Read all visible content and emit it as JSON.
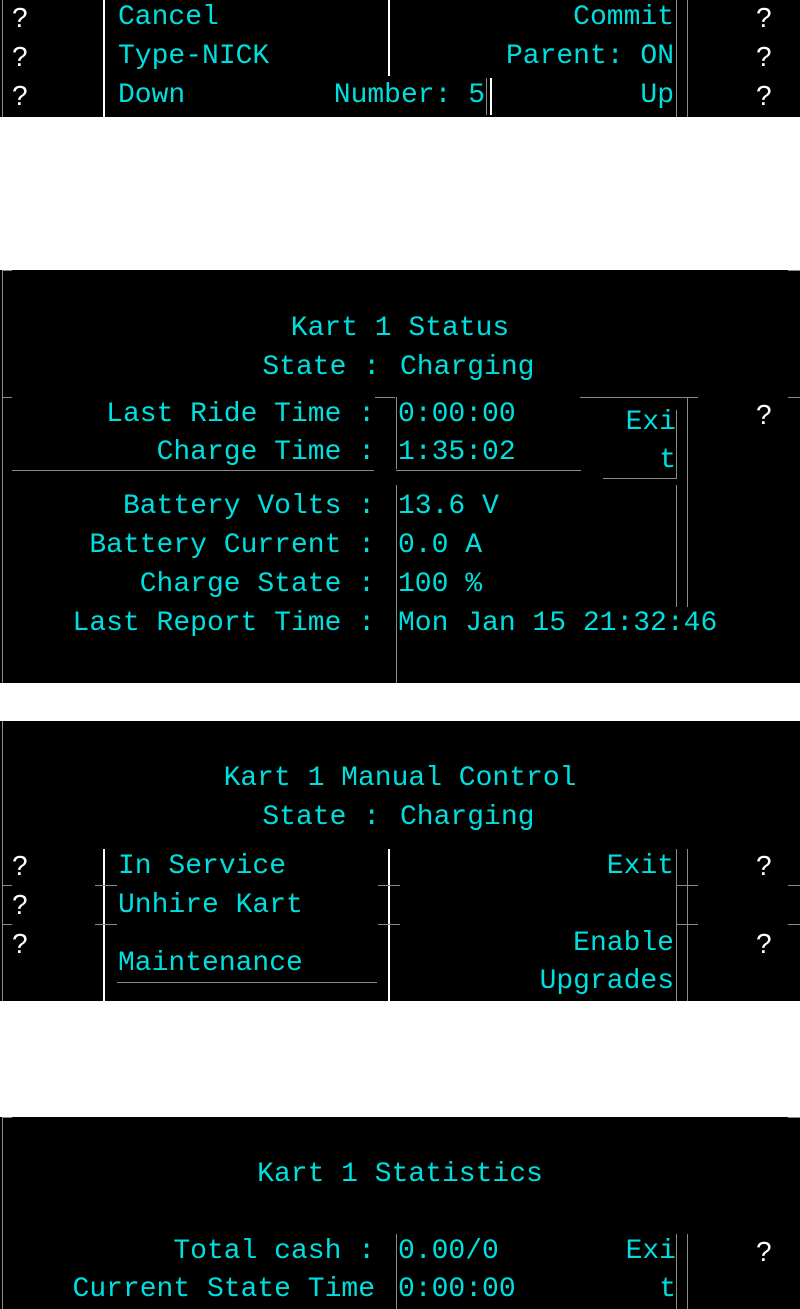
{
  "colors": {
    "text": "#00dede",
    "help": "#ffffff",
    "panel_bg": "#000000",
    "page_bg": "#ffffff",
    "separator": "#8a8a8a"
  },
  "help_icon": "?",
  "keypad": {
    "rows": [
      {
        "left": "Cancel",
        "right": "Commit"
      },
      {
        "left": "Type-NICK",
        "right": "Parent: ON"
      },
      {
        "left": "Down",
        "middle": "Number: 5",
        "right": "Up"
      }
    ]
  },
  "status": {
    "title": "Kart 1 Status",
    "state_label": "State :",
    "state_value": "Charging",
    "exit_label_line1": "Exi",
    "exit_label_line2": "t",
    "fields": [
      {
        "label": "Last Ride Time :",
        "value": "0:00:00"
      },
      {
        "label": "Charge Time :",
        "value": "1:35:02"
      },
      {
        "label": "Battery Volts :",
        "value": "13.6 V"
      },
      {
        "label": "Battery Current :",
        "value": "0.0 A"
      },
      {
        "label": "Charge State :",
        "value": "100 %"
      },
      {
        "label": "Last Report Time :",
        "value": "Mon Jan 15 21:32:46"
      }
    ]
  },
  "manual": {
    "title": "Kart 1 Manual Control",
    "state_label": "State :",
    "state_value": "Charging",
    "buttons": {
      "in_service": "In Service",
      "unhire": "Unhire Kart",
      "maintenance": "Maintenance",
      "exit": "Exit",
      "enable_line1": "Enable",
      "enable_line2": "Upgrades"
    }
  },
  "statistics": {
    "title": "Kart 1 Statistics",
    "exit_label_line1": "Exi",
    "exit_label_line2": "t",
    "fields": [
      {
        "label": "Total cash :",
        "value": "0.00/0"
      },
      {
        "label": "Current State Time",
        "value": "0:00:00"
      }
    ]
  }
}
